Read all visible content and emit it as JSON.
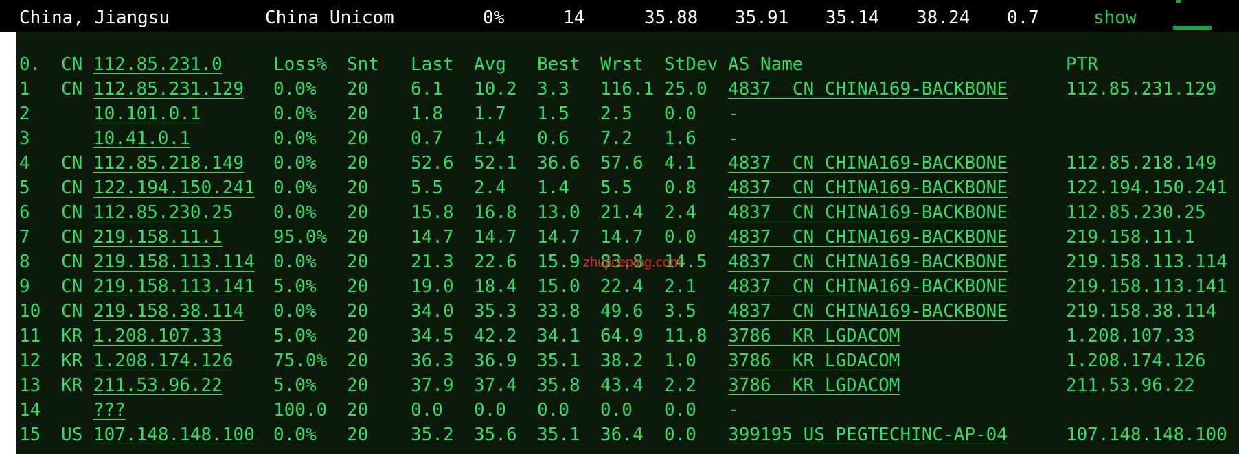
{
  "header": {
    "location": "China, Jiangsu",
    "isp": "China Unicom",
    "loss": "0%",
    "sent": "14",
    "last": "35.88",
    "avg": "35.91",
    "best": "35.14",
    "worst": "38.24",
    "stdev": "0.7",
    "action": "show"
  },
  "columns": {
    "hop": "0.",
    "cc": "CN",
    "host": "112.85.231.0",
    "loss": "Loss%",
    "snt": "Snt",
    "last": "Last",
    "avg": "Avg",
    "best": "Best",
    "wrst": "Wrst",
    "stdev": "StDev",
    "asname": "AS Name",
    "ptr": "PTR"
  },
  "rows": [
    {
      "hop": "1",
      "cc": "CN",
      "host": "112.85.231.129",
      "loss": "0.0%",
      "snt": "20",
      "last": "6.1",
      "avg": "10.2",
      "best": "3.3",
      "wrst": "116.1",
      "stdev": "25.0",
      "asname": "4837  CN CHINA169-BACKBONE",
      "ptr": "112.85.231.129"
    },
    {
      "hop": "2",
      "cc": "",
      "host": "10.101.0.1",
      "loss": "0.0%",
      "snt": "20",
      "last": "1.8",
      "avg": "1.7",
      "best": "1.5",
      "wrst": "2.5",
      "stdev": "0.0",
      "asname": "-",
      "ptr": ""
    },
    {
      "hop": "3",
      "cc": "",
      "host": "10.41.0.1",
      "loss": "0.0%",
      "snt": "20",
      "last": "0.7",
      "avg": "1.4",
      "best": "0.6",
      "wrst": "7.2",
      "stdev": "1.6",
      "asname": "-",
      "ptr": ""
    },
    {
      "hop": "4",
      "cc": "CN",
      "host": "112.85.218.149",
      "loss": "0.0%",
      "snt": "20",
      "last": "52.6",
      "avg": "52.1",
      "best": "36.6",
      "wrst": "57.6",
      "stdev": "4.1",
      "asname": "4837  CN CHINA169-BACKBONE",
      "ptr": "112.85.218.149"
    },
    {
      "hop": "5",
      "cc": "CN",
      "host": "122.194.150.241",
      "loss": "0.0%",
      "snt": "20",
      "last": "5.5",
      "avg": "2.4",
      "best": "1.4",
      "wrst": "5.5",
      "stdev": "0.8",
      "asname": "4837  CN CHINA169-BACKBONE",
      "ptr": "122.194.150.241"
    },
    {
      "hop": "6",
      "cc": "CN",
      "host": "112.85.230.25",
      "loss": "0.0%",
      "snt": "20",
      "last": "15.8",
      "avg": "16.8",
      "best": "13.0",
      "wrst": "21.4",
      "stdev": "2.4",
      "asname": "4837  CN CHINA169-BACKBONE",
      "ptr": "112.85.230.25"
    },
    {
      "hop": "7",
      "cc": "CN",
      "host": "219.158.11.1",
      "loss": "95.0%",
      "snt": "20",
      "last": "14.7",
      "avg": "14.7",
      "best": "14.7",
      "wrst": "14.7",
      "stdev": "0.0",
      "asname": "4837  CN CHINA169-BACKBONE",
      "ptr": "219.158.11.1"
    },
    {
      "hop": "8",
      "cc": "CN",
      "host": "219.158.113.114",
      "loss": "0.0%",
      "snt": "20",
      "last": "21.3",
      "avg": "22.6",
      "best": "15.9",
      "wrst": "83.8",
      "stdev": "14.5",
      "asname": "4837  CN CHINA169-BACKBONE",
      "ptr": "219.158.113.114"
    },
    {
      "hop": "9",
      "cc": "CN",
      "host": "219.158.113.141",
      "loss": "5.0%",
      "snt": "20",
      "last": "19.0",
      "avg": "18.4",
      "best": "15.0",
      "wrst": "22.4",
      "stdev": "2.1",
      "asname": "4837  CN CHINA169-BACKBONE",
      "ptr": "219.158.113.141"
    },
    {
      "hop": "10",
      "cc": "CN",
      "host": "219.158.38.114",
      "loss": "0.0%",
      "snt": "20",
      "last": "34.0",
      "avg": "35.3",
      "best": "33.8",
      "wrst": "49.6",
      "stdev": "3.5",
      "asname": "4837  CN CHINA169-BACKBONE",
      "ptr": "219.158.38.114"
    },
    {
      "hop": "11",
      "cc": "KR",
      "host": "1.208.107.33",
      "loss": "5.0%",
      "snt": "20",
      "last": "34.5",
      "avg": "42.2",
      "best": "34.1",
      "wrst": "64.9",
      "stdev": "11.8",
      "asname": "3786  KR LGDACOM",
      "ptr": "1.208.107.33"
    },
    {
      "hop": "12",
      "cc": "KR",
      "host": "1.208.174.126",
      "loss": "75.0%",
      "snt": "20",
      "last": "36.3",
      "avg": "36.9",
      "best": "35.1",
      "wrst": "38.2",
      "stdev": "1.0",
      "asname": "3786  KR LGDACOM",
      "ptr": "1.208.174.126"
    },
    {
      "hop": "13",
      "cc": "KR",
      "host": "211.53.96.22",
      "loss": "5.0%",
      "snt": "20",
      "last": "37.9",
      "avg": "37.4",
      "best": "35.8",
      "wrst": "43.4",
      "stdev": "2.2",
      "asname": "3786  KR LGDACOM",
      "ptr": "211.53.96.22"
    },
    {
      "hop": "14",
      "cc": "",
      "host": "???",
      "loss": "100.0",
      "snt": "20",
      "last": "0.0",
      "avg": "0.0",
      "best": "0.0",
      "wrst": "0.0",
      "stdev": "0.0",
      "asname": "-",
      "ptr": ""
    },
    {
      "hop": "15",
      "cc": "US",
      "host": "107.148.148.100",
      "loss": "0.0%",
      "snt": "20",
      "last": "35.2",
      "avg": "35.6",
      "best": "35.1",
      "wrst": "36.4",
      "stdev": "0.0",
      "asname": "399195 US PEGTECHINC-AP-04",
      "ptr": "107.148.148.100"
    }
  ],
  "watermark": "zhujiceping.com",
  "colors": {
    "terminal_bg": "#0b1a0b",
    "terminal_text": "#33dd66",
    "header_bg": "#000000",
    "header_text": "#ffffff",
    "link": "#22cc55",
    "watermark": "#e0222c"
  }
}
